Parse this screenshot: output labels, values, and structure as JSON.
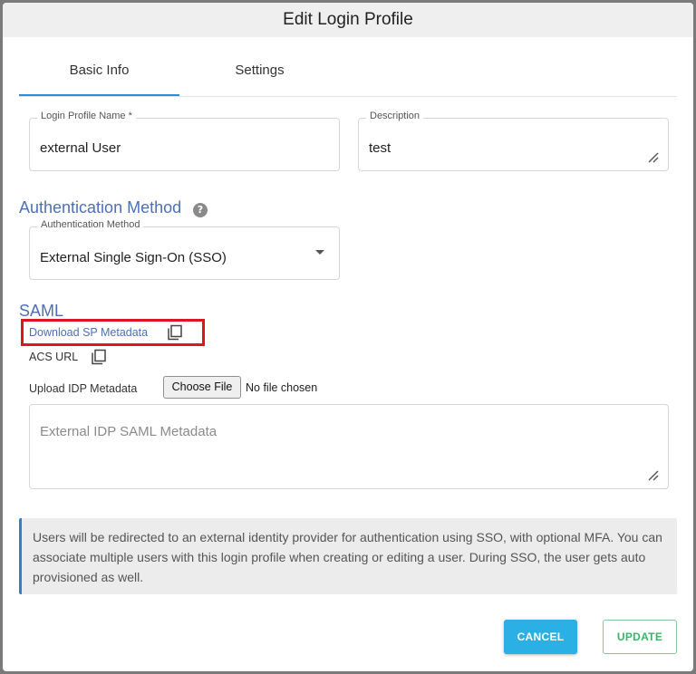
{
  "dialog": {
    "title": "Edit Login Profile"
  },
  "tabs": [
    {
      "label": "Basic Info",
      "active": true
    },
    {
      "label": "Settings",
      "active": false
    }
  ],
  "fields": {
    "login_profile_name": {
      "label": "Login Profile Name *",
      "value": "external User"
    },
    "description": {
      "label": "Description",
      "value": "test"
    }
  },
  "auth": {
    "section_title": "Authentication Method",
    "help_icon": "question-circle-icon",
    "select_label": "Authentication Method",
    "select_value": "External Single Sign-On (SSO)"
  },
  "saml": {
    "section_title": "SAML",
    "download_link": "Download SP Metadata",
    "acs_label": "ACS URL",
    "upload_label": "Upload IDP Metadata",
    "choose_file": "Choose File",
    "no_file": "No file chosen",
    "metadata_placeholder": "External IDP SAML Metadata"
  },
  "info": {
    "text": "Users will be redirected to an external identity provider for authentication using SSO, with optional MFA. You can associate multiple users with this login profile when creating or editing a user. During SSO, the user gets auto provisioned as well."
  },
  "actions": {
    "cancel": "CANCEL",
    "update": "UPDATE"
  },
  "colors": {
    "accent": "#2f8bd4",
    "section": "#4e6fb6",
    "highlight": "#e0141e",
    "cancel_bg": "#2bb0e6",
    "update_text": "#3db26a"
  }
}
